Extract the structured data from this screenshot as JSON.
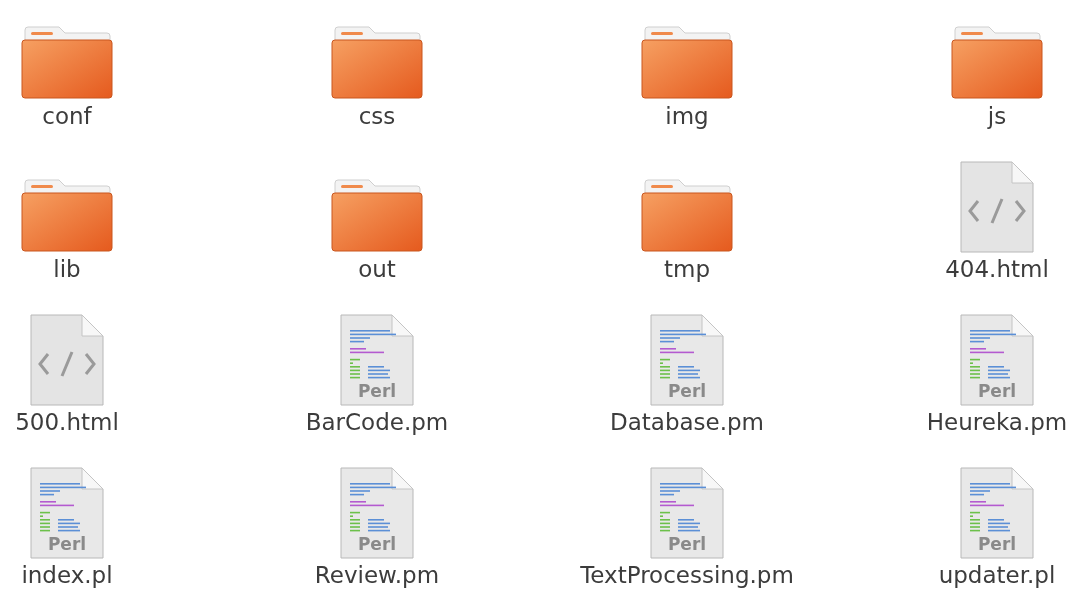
{
  "rows": [
    {
      "files": [
        {
          "kind": "folder",
          "name": "conf"
        },
        {
          "kind": "folder",
          "name": "css"
        },
        {
          "kind": "folder",
          "name": "img"
        },
        {
          "kind": "folder",
          "name": "js"
        }
      ]
    },
    {
      "files": [
        {
          "kind": "folder",
          "name": "lib"
        },
        {
          "kind": "folder",
          "name": "out"
        },
        {
          "kind": "folder",
          "name": "tmp"
        },
        {
          "kind": "html",
          "name": "404.html"
        }
      ]
    },
    {
      "files": [
        {
          "kind": "html",
          "name": "500.html"
        },
        {
          "kind": "perl",
          "name": "BarCode.pm",
          "badge": "Perl"
        },
        {
          "kind": "perl",
          "name": "Database.pm",
          "badge": "Perl"
        },
        {
          "kind": "perl",
          "name": "Heureka.pm",
          "badge": "Perl"
        }
      ]
    },
    {
      "files": [
        {
          "kind": "perl",
          "name": "index.pl",
          "badge": "Perl"
        },
        {
          "kind": "perl",
          "name": "Review.pm",
          "badge": "Perl"
        },
        {
          "kind": "perl",
          "name": "TextProcessing.pm",
          "badge": "Perl"
        },
        {
          "kind": "perl",
          "name": "updater.pl",
          "badge": "Perl"
        }
      ]
    }
  ]
}
